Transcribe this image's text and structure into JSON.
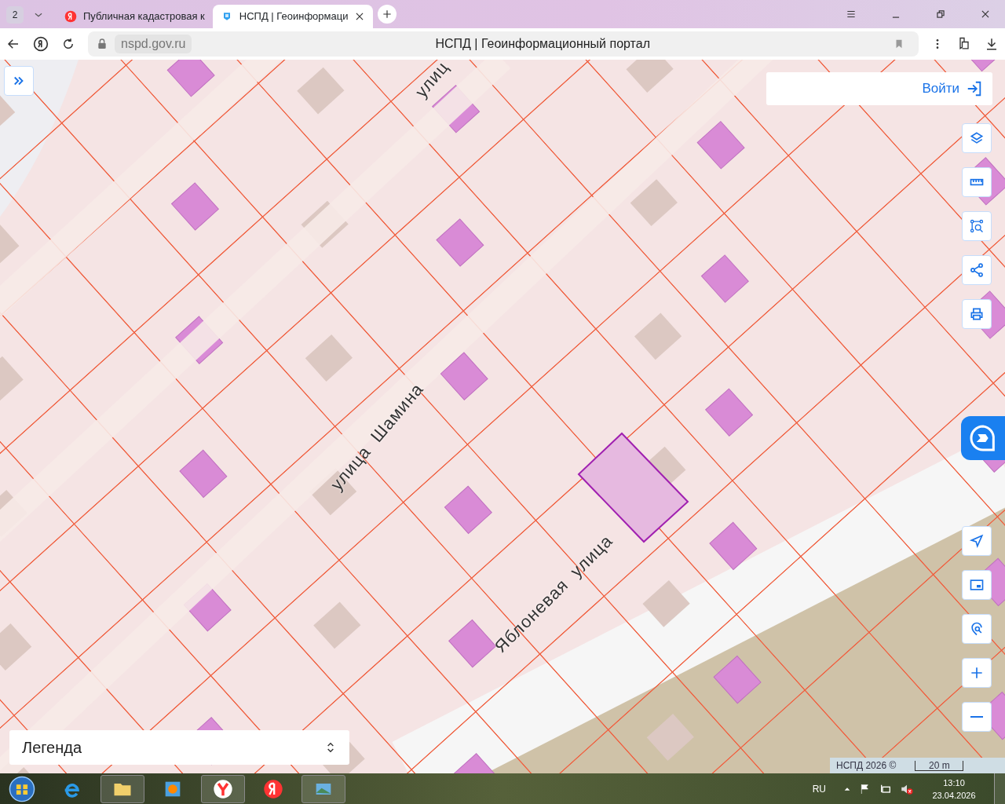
{
  "browser": {
    "tab_count": "2",
    "tabs": [
      {
        "title": "Публичная кадастровая к",
        "selected": false,
        "kind": "yandex"
      },
      {
        "title": "НСПД | Геоинформаци",
        "selected": true,
        "kind": "nspd"
      }
    ],
    "address": "nspd.gov.ru",
    "page_title": "НСПД | Геоинформационный портал"
  },
  "map": {
    "street_labels": [
      {
        "text": "улиц",
        "kind": "top"
      },
      {
        "text": "улица  Шамина",
        "kind": "middle"
      },
      {
        "text": "Яблоневая  улица",
        "kind": "bottom"
      }
    ],
    "login_button": "Войти",
    "tools_top": [
      {
        "kind": "layers"
      },
      {
        "kind": "ruler"
      },
      {
        "kind": "select"
      },
      {
        "kind": "share"
      },
      {
        "kind": "print"
      }
    ],
    "tools_bottom": [
      {
        "kind": "locate"
      },
      {
        "kind": "minimap"
      },
      {
        "kind": "search-point"
      },
      {
        "kind": "zoom-in"
      },
      {
        "kind": "zoom-out"
      }
    ],
    "legend": "Легенда",
    "attribution": "НСПД 2026 ©",
    "scale": "20 m"
  },
  "taskbar": {
    "language": "RU",
    "time": "13:10",
    "date": "23.04.2026"
  }
}
